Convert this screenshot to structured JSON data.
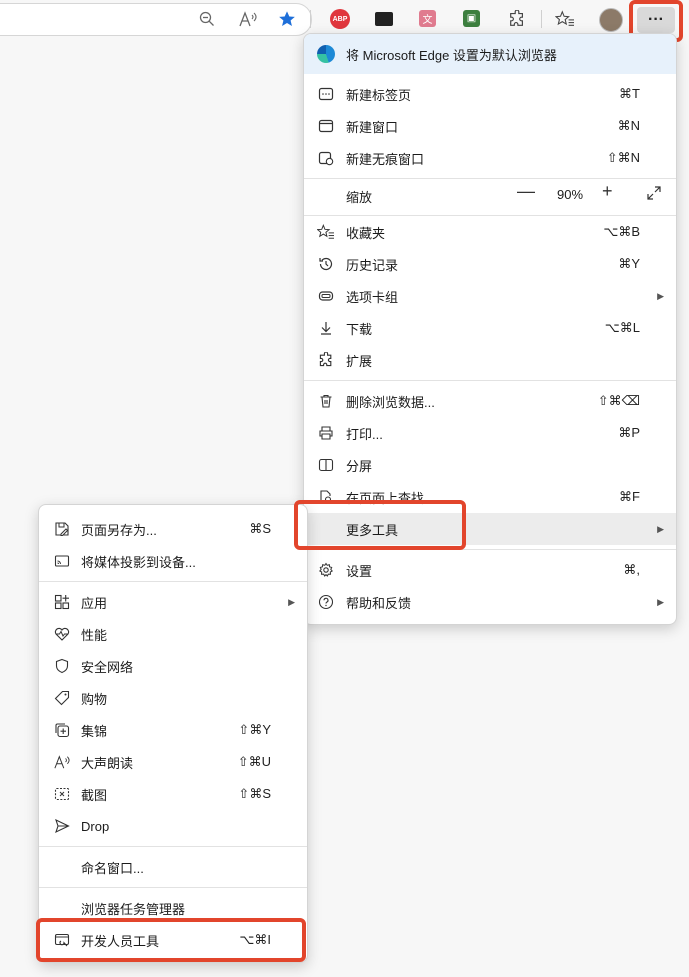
{
  "toolbar": {
    "abp_label": "ABP",
    "more_label": "···"
  },
  "main_menu": {
    "banner": "将 Microsoft Edge 设置为默认浏览器",
    "new_tab": {
      "label": "新建标签页",
      "shortcut": "⌘T"
    },
    "new_window": {
      "label": "新建窗口",
      "shortcut": "⌘N"
    },
    "new_private": {
      "label": "新建无痕窗口",
      "shortcut": "⇧⌘N"
    },
    "zoom": {
      "label": "缩放",
      "minus": "—",
      "value": "90%",
      "plus": "+"
    },
    "favorites": {
      "label": "收藏夹",
      "shortcut": "⌥⌘B"
    },
    "history": {
      "label": "历史记录",
      "shortcut": "⌘Y"
    },
    "tab_groups": {
      "label": "选项卡组"
    },
    "downloads": {
      "label": "下载",
      "shortcut": "⌥⌘L"
    },
    "extensions": {
      "label": "扩展"
    },
    "clear_data": {
      "label": "删除浏览数据...",
      "shortcut": "⇧⌘⌫"
    },
    "print": {
      "label": "打印...",
      "shortcut": "⌘P"
    },
    "split": {
      "label": "分屏"
    },
    "find": {
      "label": "在页面上查找",
      "shortcut": "⌘F"
    },
    "more_tools": {
      "label": "更多工具"
    },
    "settings": {
      "label": "设置",
      "shortcut": "⌘,"
    },
    "help": {
      "label": "帮助和反馈"
    }
  },
  "sub_menu": {
    "save_as": {
      "label": "页面另存为...",
      "shortcut": "⌘S"
    },
    "cast": {
      "label": "将媒体投影到设备..."
    },
    "apps": {
      "label": "应用"
    },
    "performance": {
      "label": "性能"
    },
    "safety": {
      "label": "安全网络"
    },
    "shopping": {
      "label": "购物"
    },
    "collections": {
      "label": "集锦",
      "shortcut": "⇧⌘Y"
    },
    "read_aloud": {
      "label": "大声朗读",
      "shortcut": "⇧⌘U"
    },
    "screenshot": {
      "label": "截图",
      "shortcut": "⇧⌘S"
    },
    "drop": {
      "label": "Drop"
    },
    "name_window": {
      "label": "命名窗口..."
    },
    "task_manager": {
      "label": "浏览器任务管理器"
    },
    "dev_tools": {
      "label": "开发人员工具",
      "shortcut": "⌥⌘I"
    }
  }
}
